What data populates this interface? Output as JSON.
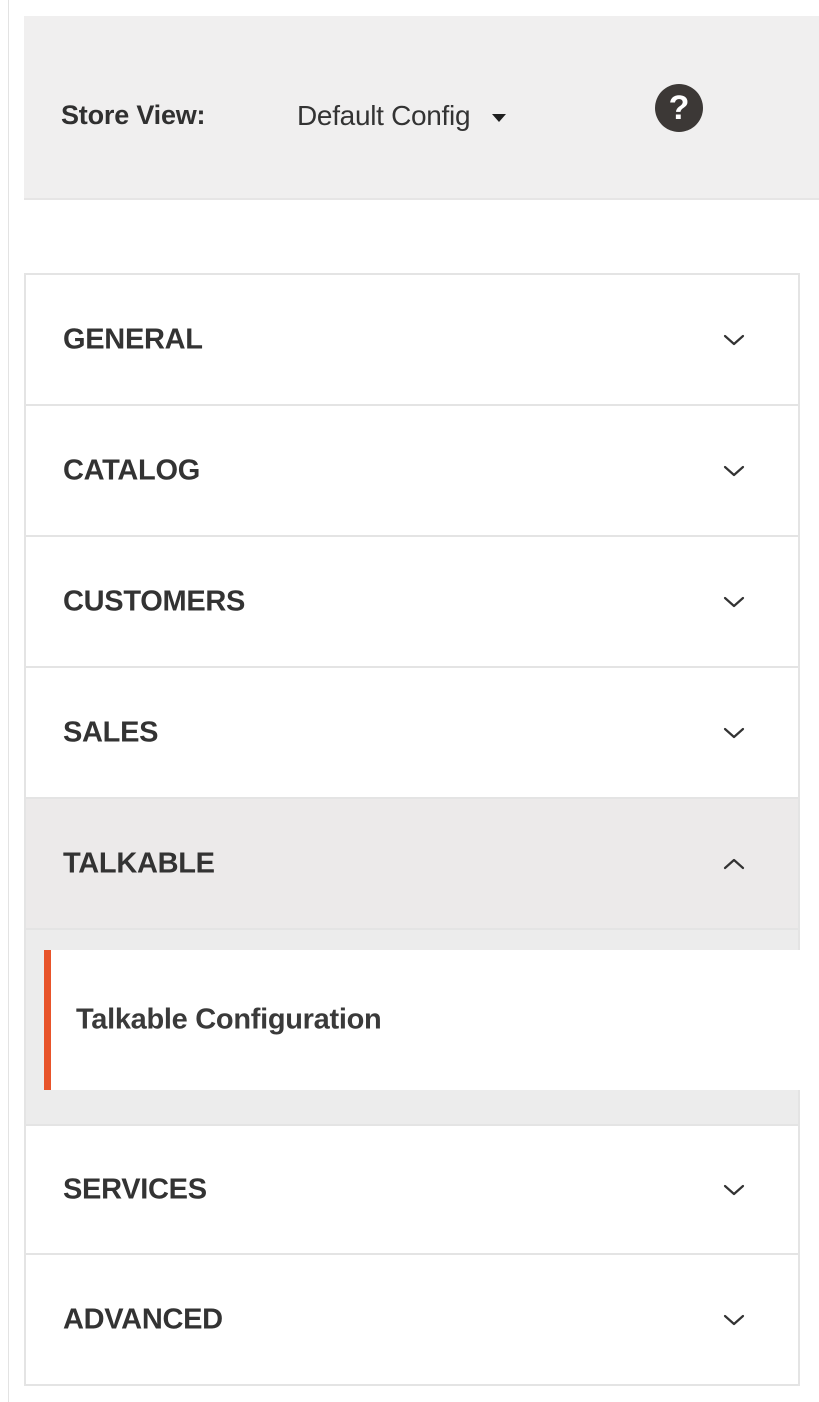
{
  "store_view": {
    "label": "Store View:",
    "selected": "Default Config"
  },
  "help": {
    "glyph": "?"
  },
  "tabs": [
    {
      "label": "GENERAL",
      "expanded": false
    },
    {
      "label": "CATALOG",
      "expanded": false
    },
    {
      "label": "CUSTOMERS",
      "expanded": false
    },
    {
      "label": "SALES",
      "expanded": false
    },
    {
      "label": "TALKABLE",
      "expanded": true,
      "items": [
        {
          "label": "Talkable Configuration",
          "active": true
        }
      ]
    },
    {
      "label": "SERVICES",
      "expanded": false
    },
    {
      "label": "ADVANCED",
      "expanded": false
    }
  ],
  "colors": {
    "accent": "#e8542a",
    "header_bg": "#f0efef",
    "active_tab_bg": "#eceaea",
    "border": "#e4e4e4",
    "text": "#333333"
  },
  "icons": {
    "collapsed": "chevron-down-icon",
    "expanded": "chevron-up-icon",
    "help": "question-circle-icon",
    "dropdown": "caret-down-icon"
  }
}
